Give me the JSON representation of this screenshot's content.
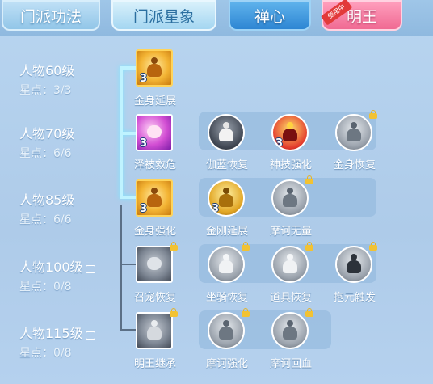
{
  "tabs": [
    {
      "label": "门派功法"
    },
    {
      "label": "门派星象"
    },
    {
      "label": "禅心"
    },
    {
      "label": "明王",
      "badge": "使用中"
    }
  ],
  "rows": [
    {
      "level": "人物60级",
      "stars": "星点：3/3",
      "locked": false
    },
    {
      "level": "人物70级",
      "stars": "星点：6/6",
      "locked": false
    },
    {
      "level": "人物85级",
      "stars": "星点：6/6",
      "locked": false
    },
    {
      "level": "人物100级",
      "stars": "星点：0/8",
      "locked": true
    },
    {
      "level": "人物115级",
      "stars": "星点：0/8",
      "locked": true
    }
  ],
  "skills": {
    "r0": [
      {
        "name": "金身延展",
        "count": "3",
        "icon": "meditating-monk-icon"
      }
    ],
    "r1": [
      {
        "name": "泽被救危",
        "count": "3",
        "icon": "glowing-hand-icon"
      },
      {
        "name": "伽蓝恢复",
        "count": "",
        "icon": "multi-arm-deity-icon"
      },
      {
        "name": "神技强化",
        "count": "3",
        "icon": "red-demon-mask-icon"
      },
      {
        "name": "金身恢复",
        "count": "",
        "icon": "armored-guardian-icon"
      }
    ],
    "r2": [
      {
        "name": "金身强化",
        "count": "3",
        "icon": "meditating-monk-icon"
      },
      {
        "name": "金刚延展",
        "count": "3",
        "icon": "golden-warrior-icon"
      },
      {
        "name": "摩诃无量",
        "count": "",
        "icon": "monk-portrait-icon"
      }
    ],
    "r3": [
      {
        "name": "召宠恢复",
        "count": "",
        "icon": "spirit-swirl-icon"
      },
      {
        "name": "坐骑恢复",
        "count": "",
        "icon": "warrior-figure-icon"
      },
      {
        "name": "道具恢复",
        "count": "",
        "icon": "radiant-buddha-icon"
      },
      {
        "name": "抱元触发",
        "count": "",
        "icon": "meditation-silhouette-icon"
      }
    ],
    "r4": [
      {
        "name": "明王继承",
        "count": "",
        "icon": "wrathful-king-icon"
      },
      {
        "name": "摩诃强化",
        "count": "",
        "icon": "monk-portrait-icon"
      },
      {
        "name": "摩诃回血",
        "count": "",
        "icon": "monk-portrait-icon"
      }
    ]
  },
  "colors": {
    "active_link": "#bff3ff",
    "inactive_link": "#5b6f86",
    "lock": "#f2c233"
  }
}
